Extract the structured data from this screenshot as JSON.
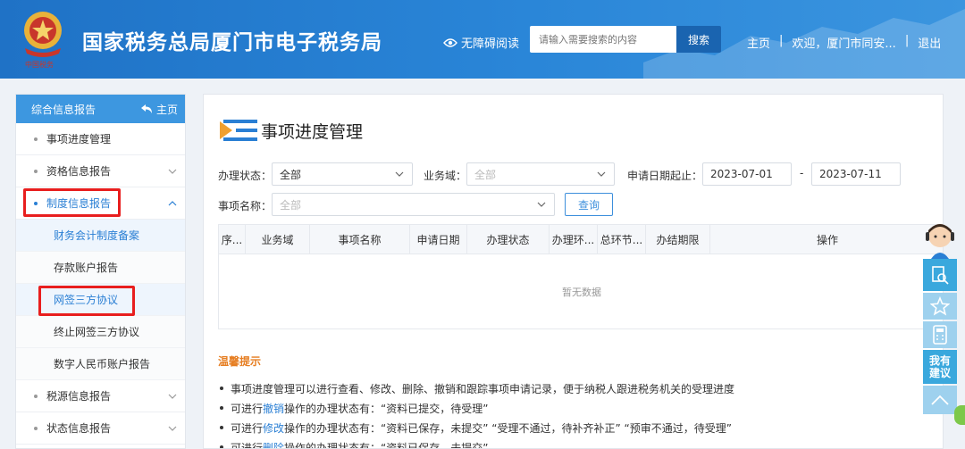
{
  "header": {
    "title": "国家税务总局厦门市电子税务局",
    "accessibility": "无障碍阅读",
    "search_placeholder": "请输入需要搜索的内容",
    "search_button": "搜索",
    "nav": {
      "home": "主页",
      "sep": "|",
      "welcome": "欢迎，厦门市同安...",
      "logout": "退出"
    },
    "colors": {
      "brand": "#2a86d8"
    }
  },
  "sidebar": {
    "head_title": "综合信息报告",
    "head_home": "主页",
    "items": [
      {
        "label": "事项进度管理"
      },
      {
        "label": "资格信息报告"
      },
      {
        "label": "制度信息报告"
      },
      {
        "label": "税源信息报告"
      },
      {
        "label": "状态信息报告"
      }
    ],
    "subitems": [
      {
        "label": "财务会计制度备案"
      },
      {
        "label": "存款账户报告"
      },
      {
        "label": "网签三方协议"
      },
      {
        "label": "终止网签三方协议"
      },
      {
        "label": "数字人民币账户报告"
      }
    ]
  },
  "main": {
    "title": "事项进度管理",
    "filters": {
      "status_label": "办理状态：",
      "status_value": "全部",
      "domain_label": "业务域：",
      "domain_placeholder": "全部",
      "date_label": "申请日期起止：",
      "date_from": "2023-07-01",
      "date_sep": "-",
      "date_to": "2023-07-11",
      "name_label": "事项名称：",
      "name_placeholder": "全部",
      "query_button": "查询"
    },
    "table": {
      "columns": [
        "序...",
        "业务域",
        "事项名称",
        "申请日期",
        "办理状态",
        "办理环...",
        "总环节...",
        "办结期限",
        "操作"
      ],
      "empty_text": "暂无数据"
    },
    "tips": {
      "title": "温馨提示",
      "items": [
        {
          "pre": "事项进度管理可以进行查看、修改、删除、撤销和跟踪事项申请记录，便于纳税人跟进税务机关的受理进度",
          "link": "",
          "post": ""
        },
        {
          "pre": "可进行",
          "link": "撤销",
          "post": "操作的办理状态有：“资料已提交，待受理”"
        },
        {
          "pre": "可进行",
          "link": "修改",
          "post": "操作的办理状态有：“资料已保存，未提交” “受理不通过，待补齐补正” “预审不通过，待受理”"
        },
        {
          "pre": "可进行",
          "link": "删除",
          "post": "操作的办理状态有：“资料已保存，未提交”"
        }
      ]
    }
  },
  "float_bar": {
    "suggest_line1": "我有",
    "suggest_line2": "建议"
  }
}
